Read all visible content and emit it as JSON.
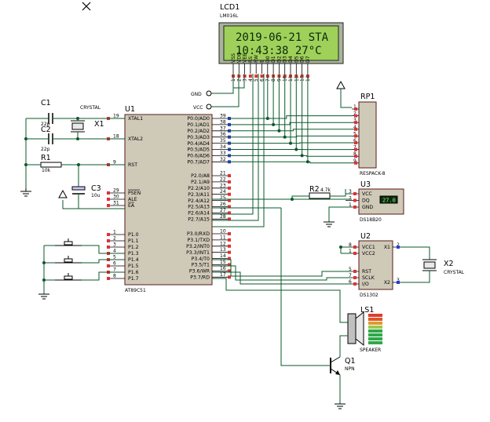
{
  "lcd": {
    "ref": "LCD1",
    "part": "LM016L",
    "line1": "2019-06-21 STA",
    "line2": "10:43:38  27°C",
    "pins": [
      "VSS",
      "VDD",
      "VEE",
      "RS",
      "RW",
      "E",
      "D0",
      "D1",
      "D2",
      "D3",
      "D4",
      "D5",
      "D6",
      "D7"
    ],
    "pin_numbers": [
      "1",
      "2",
      "3",
      "4",
      "5",
      "6",
      "7",
      "8",
      "9",
      "10",
      "11",
      "12",
      "13",
      "14"
    ]
  },
  "mcu": {
    "ref": "U1",
    "part": "AT89C51",
    "left_pins": [
      {
        "num": "19",
        "name": "XTAL1"
      },
      {
        "num": "18",
        "name": "XTAL2"
      },
      {
        "num": "9",
        "name": "RST"
      },
      {
        "num": "29",
        "name": "PSEN"
      },
      {
        "num": "30",
        "name": "ALE"
      },
      {
        "num": "31",
        "name": "EA"
      },
      {
        "num": "1",
        "name": "P1.0"
      },
      {
        "num": "2",
        "name": "P1.1"
      },
      {
        "num": "3",
        "name": "P1.2"
      },
      {
        "num": "4",
        "name": "P1.3"
      },
      {
        "num": "5",
        "name": "P1.4"
      },
      {
        "num": "6",
        "name": "P1.5"
      },
      {
        "num": "7",
        "name": "P1.6"
      },
      {
        "num": "8",
        "name": "P1.7"
      }
    ],
    "right_pins": [
      {
        "num": "39",
        "name": "P0.0/AD0"
      },
      {
        "num": "38",
        "name": "P0.1/AD1"
      },
      {
        "num": "37",
        "name": "P0.2/AD2"
      },
      {
        "num": "36",
        "name": "P0.3/AD3"
      },
      {
        "num": "35",
        "name": "P0.4/AD4"
      },
      {
        "num": "34",
        "name": "P0.5/AD5"
      },
      {
        "num": "33",
        "name": "P0.6/AD6"
      },
      {
        "num": "32",
        "name": "P0.7/AD7"
      },
      {
        "num": "21",
        "name": "P2.0/A8"
      },
      {
        "num": "22",
        "name": "P2.1/A9"
      },
      {
        "num": "23",
        "name": "P2.2/A10"
      },
      {
        "num": "24",
        "name": "P2.3/A11"
      },
      {
        "num": "25",
        "name": "P2.4/A12"
      },
      {
        "num": "26",
        "name": "P2.5/A13"
      },
      {
        "num": "27",
        "name": "P2.6/A14"
      },
      {
        "num": "28",
        "name": "P2.7/A15"
      },
      {
        "num": "10",
        "name": "P3.0/RXD"
      },
      {
        "num": "11",
        "name": "P3.1/TXD"
      },
      {
        "num": "12",
        "name": "P3.2/INT0"
      },
      {
        "num": "13",
        "name": "P3.3/INT1"
      },
      {
        "num": "14",
        "name": "P3.4/T0"
      },
      {
        "num": "15",
        "name": "P3.5/T1"
      },
      {
        "num": "16",
        "name": "P3.6/WR"
      },
      {
        "num": "17",
        "name": "P3.7/RD"
      }
    ]
  },
  "c1": {
    "ref": "C1",
    "value": "22p"
  },
  "c2": {
    "ref": "C2",
    "value": "22p"
  },
  "x1": {
    "ref": "X1",
    "part": "CRYSTAL"
  },
  "r1": {
    "ref": "R1",
    "value": "10k"
  },
  "c3": {
    "ref": "C3",
    "value": "10u"
  },
  "r2": {
    "ref": "R2",
    "value": "4.7k"
  },
  "rp1": {
    "ref": "RP1",
    "part": "RESPACK-8",
    "pins": [
      "1",
      "2",
      "3",
      "4",
      "5",
      "6",
      "7",
      "8",
      "9"
    ]
  },
  "u3": {
    "ref": "U3",
    "part": "DS18B20",
    "pins": [
      {
        "num": "3",
        "name": "VCC"
      },
      {
        "num": "2",
        "name": "DQ"
      },
      {
        "num": "1",
        "name": "GND"
      }
    ],
    "reading": "27.0"
  },
  "u2": {
    "ref": "U2",
    "part": "DS1302",
    "left_pins": [
      {
        "num": "8",
        "name": "VCC1"
      },
      {
        "num": "1",
        "name": "VCC2"
      },
      {
        "num": "5",
        "name": "RST"
      },
      {
        "num": "7",
        "name": "SCLK"
      },
      {
        "num": "6",
        "name": "I/O"
      }
    ],
    "right_pins": [
      {
        "num": "2",
        "name": "X1"
      },
      {
        "num": "3",
        "name": "X2"
      }
    ]
  },
  "x2": {
    "ref": "X2",
    "part": "CRYSTAL"
  },
  "ls1": {
    "ref": "LS1",
    "part": "SPEAKER"
  },
  "q1": {
    "ref": "Q1",
    "part": "NPN"
  },
  "terminals": {
    "gnd": "GND",
    "vcc": "VCC"
  }
}
